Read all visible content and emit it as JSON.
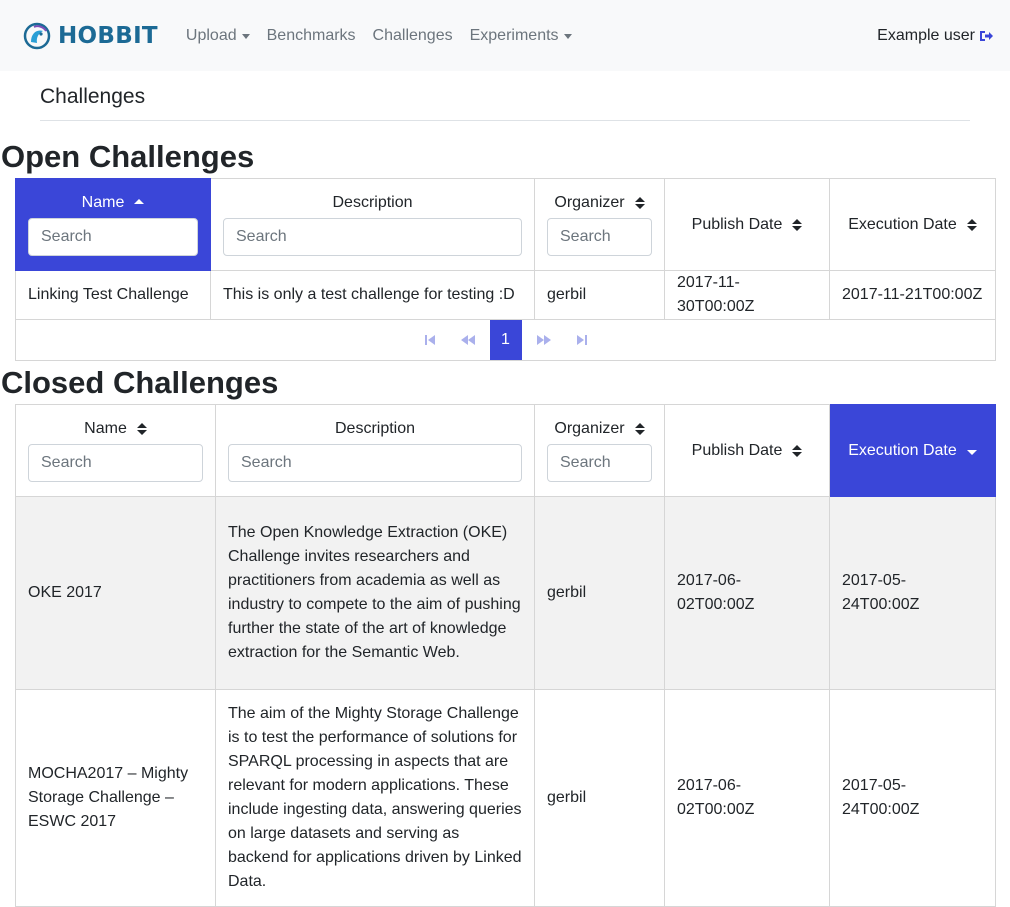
{
  "navbar": {
    "brand": "HOBBIT",
    "items": [
      {
        "label": "Upload",
        "dropdown": true
      },
      {
        "label": "Benchmarks",
        "dropdown": false
      },
      {
        "label": "Challenges",
        "dropdown": false
      },
      {
        "label": "Experiments",
        "dropdown": true
      }
    ],
    "user": "Example user"
  },
  "page_title": "Challenges",
  "open": {
    "heading": "Open Challenges",
    "columns": [
      "Name",
      "Description",
      "Organizer",
      "Publish Date",
      "Execution Date"
    ],
    "search_placeholder": "Search",
    "rows": [
      {
        "name": "Linking Test Challenge",
        "description": "This is only a test challenge for testing :D",
        "organizer": "gerbil",
        "publish": "2017-11-30T00:00Z",
        "execution": "2017-11-21T00:00Z"
      }
    ],
    "pager": {
      "current": "1"
    }
  },
  "closed": {
    "heading": "Closed Challenges",
    "columns": [
      "Name",
      "Description",
      "Organizer",
      "Publish Date",
      "Execution Date"
    ],
    "search_placeholder": "Search",
    "rows": [
      {
        "name": "OKE 2017",
        "description": "The Open Knowledge Extraction (OKE) Challenge invites researchers and practitioners from academia as well as industry to compete to the aim of pushing further the state of the art of knowledge extraction for the Semantic Web.",
        "organizer": "gerbil",
        "publish": "2017-06-02T00:00Z",
        "execution": "2017-05-24T00:00Z"
      },
      {
        "name": "MOCHA2017 – Mighty Storage Challenge – ESWC 2017",
        "description": "The aim of the Mighty Storage Challenge is to test the performance of solutions for SPARQL processing in aspects that are relevant for modern applications. These include ingesting data, answering queries on large datasets and serving as backend for applications driven by Linked Data.",
        "organizer": "gerbil",
        "publish": "2017-06-02T00:00Z",
        "execution": "2017-05-24T00:00Z"
      }
    ]
  },
  "colors": {
    "accent": "#3a46d8",
    "brand": "#1c6a95",
    "navbar_bg": "#f8f9fa"
  }
}
